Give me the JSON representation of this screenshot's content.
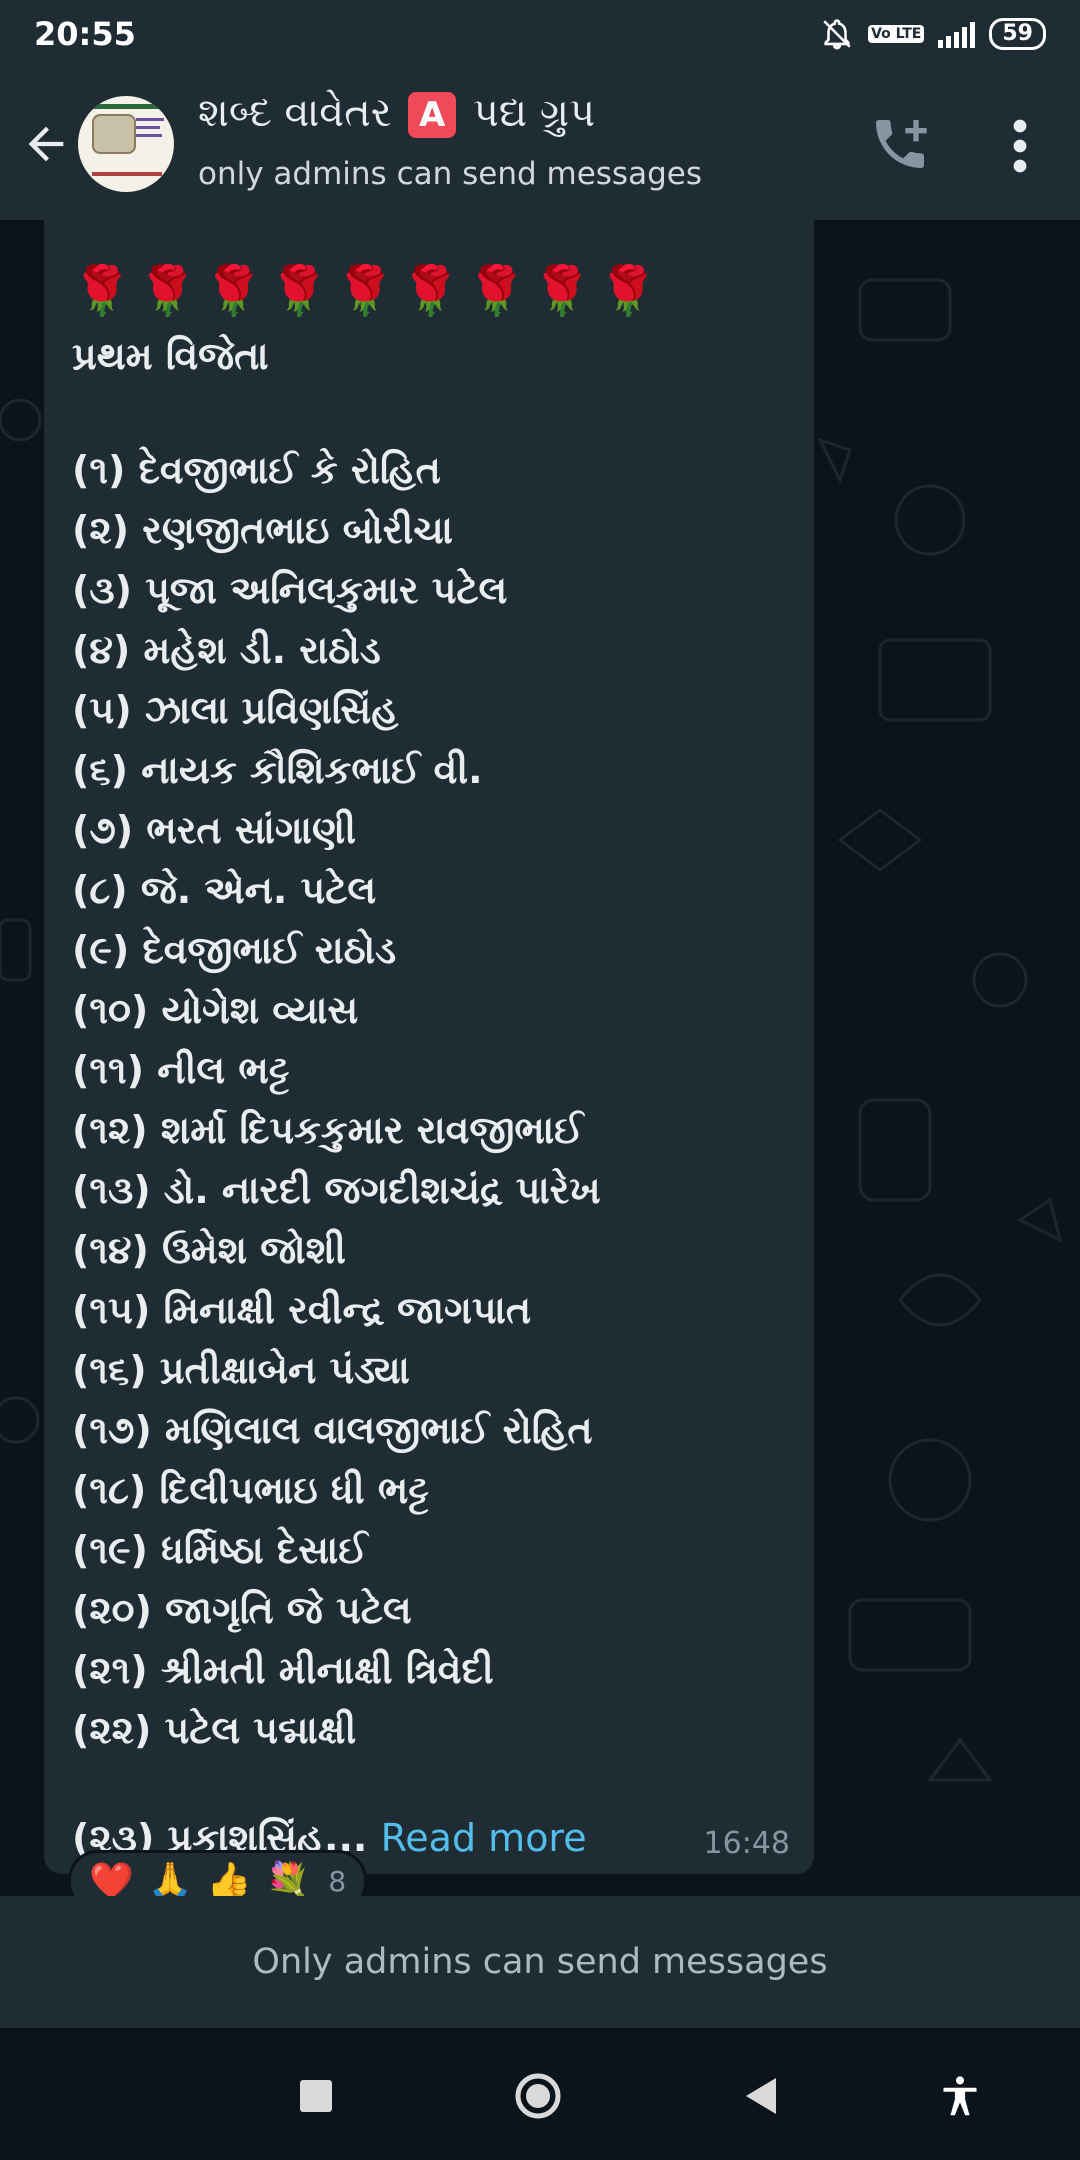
{
  "status_bar": {
    "time": "20:55",
    "volte": "Vo LTE",
    "battery": "59"
  },
  "header": {
    "title_before": "શબ્દ વાવેતર ",
    "title_badge": "A",
    "title_after": " પદ્ય ગ્રુપ",
    "subtitle": "only admins can send messages"
  },
  "message": {
    "roses": "🌹🌹🌹🌹🌹🌹🌹🌹🌹",
    "heading": "પ્રથમ વિજેતા",
    "winners": [
      "(૧) દેવજીભાઈ કે રોહિત",
      "(૨) રણજીતભાઇ બોરીચા",
      "(૩) પૂજા અનિલકુમાર પટેલ",
      "(૪) મહેશ ડી. રાઠોડ",
      "(૫) ઝાલા પ્રવિણસિંહ",
      "(૬) નાયક કૌશિકભાઈ વી.",
      "(૭) ભરત સાંગાણી",
      "(૮) જે. એન. પટેલ",
      "(૯) દેવજીભાઈ રાઠોડ",
      "(૧૦) યોગેશ વ્યાસ",
      "(૧૧) નીલ ભટ્ટ",
      "(૧૨) શર્મા દિપકકુમાર રાવજીભાઈ",
      "(૧૩) ડો. નારદી જગદીશચંદ્ર પારેખ",
      "(૧૪) ઉમેશ જોશી",
      "(૧૫) મિનાક્ષી રવીન્દ્ર જાગપાત",
      "(૧૬) પ્રતીક્ષાબેન પંડ્યા",
      "(૧૭) મણિલાલ વાલજીભાઈ રોહિત",
      "(૧૮) દિલીપભાઇ ધી ભટ્ટ",
      "(૧૯) ધર્મિષ્ઠા દેસાઈ",
      "(૨૦) જાગૃતિ જે પટેલ",
      "(૨૧) શ્રીમતી મીનાક્ષી ત્રિવેદી",
      "(૨૨) પટેલ પદ્માક્ષી"
    ],
    "last_line": "(૨૩) પ્રકાશસિંહ...",
    "read_more": "Read more",
    "time": "16:48",
    "reactions": [
      "❤️",
      "🙏",
      "👍",
      "💐"
    ],
    "reaction_count": "8"
  },
  "footer": {
    "admin_notice": "Only admins can send messages"
  },
  "colors": {
    "header_bg": "#1f2c34",
    "chat_bg": "#0b141a",
    "bubble_bg": "#202c33",
    "link": "#53bdeb",
    "muted": "#8696a0"
  }
}
